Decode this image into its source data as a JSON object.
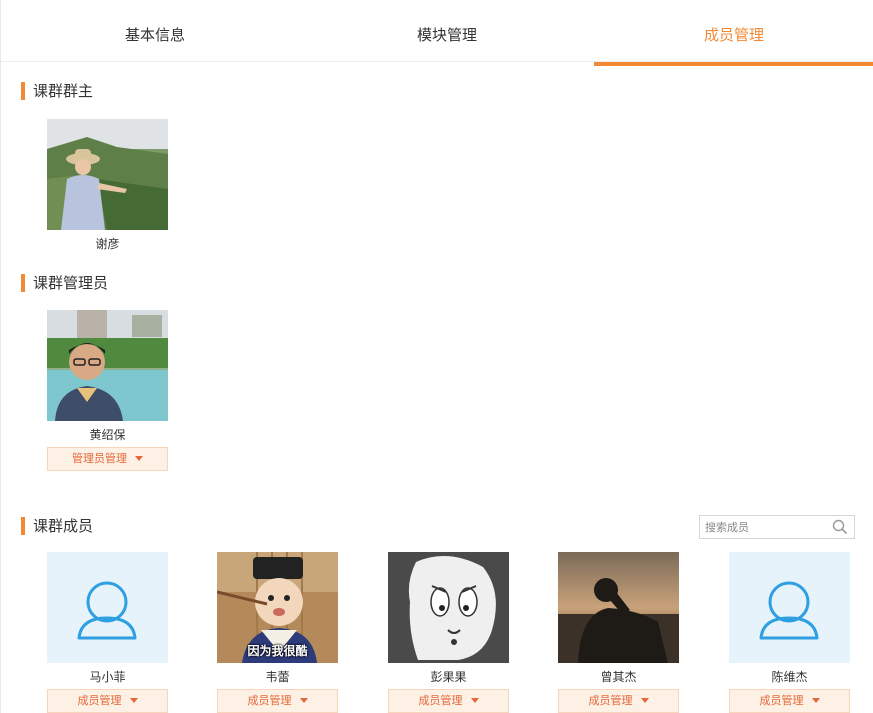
{
  "tabs": [
    {
      "label": "基本信息",
      "active": false
    },
    {
      "label": "模块管理",
      "active": false
    },
    {
      "label": "成员管理",
      "active": true
    }
  ],
  "accent_color": "#f28a35",
  "owner_section": {
    "title": "课群群主",
    "member": {
      "name": "谢彦",
      "avatar": "photo-woman-hat"
    }
  },
  "admin_section": {
    "title": "课群管理员",
    "member": {
      "name": "黄绍保",
      "avatar": "photo-man-glasses",
      "action_label": "管理员管理"
    }
  },
  "members_section": {
    "title": "课群成员",
    "search_placeholder": "搜索成员",
    "members": [
      {
        "name": "马小菲",
        "avatar": "default-user-icon",
        "action_label": "成员管理"
      },
      {
        "name": "韦蕾",
        "avatar": "photo-child-meme",
        "avatar_caption": "因为我很酷",
        "action_label": "成员管理"
      },
      {
        "name": "彭果果",
        "avatar": "photo-cartoon-ghost",
        "action_label": "成员管理"
      },
      {
        "name": "曾其杰",
        "avatar": "photo-sunset-silhouette",
        "action_label": "成员管理"
      },
      {
        "name": "陈维杰",
        "avatar": "default-user-icon",
        "action_label": "成员管理"
      }
    ]
  }
}
